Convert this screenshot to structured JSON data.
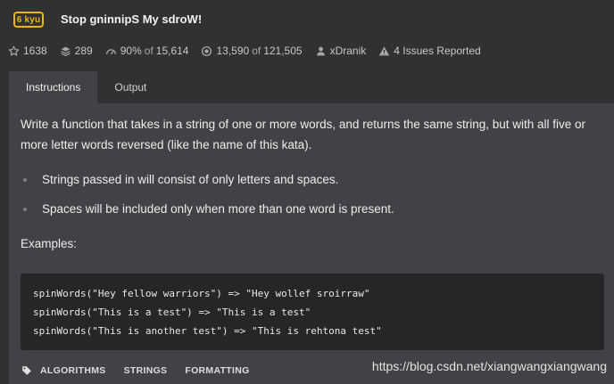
{
  "kata": {
    "rank": "6 kyu",
    "title": "Stop gninnipS My sdroW!"
  },
  "stats": {
    "stars": "1638",
    "collections": "289",
    "satisfaction": "90%",
    "satisfaction_of": "of",
    "satisfaction_total": "15,614",
    "completed": "13,590",
    "completed_of": "of",
    "completed_total": "121,505",
    "author": "xDranik",
    "issues": "4 Issues Reported"
  },
  "tabs": [
    {
      "label": "Instructions",
      "active": true
    },
    {
      "label": "Output",
      "active": false
    }
  ],
  "instructions": {
    "description": "Write a function that takes in a string of one or more words, and returns the same string, but with all five or more letter words reversed (like the name of this kata).",
    "bullets": [
      "Strings passed in will consist of only letters and spaces.",
      "Spaces will be included only when more than one word is present."
    ],
    "examples_heading": "Examples:",
    "code_lines": [
      "spinWords(\"Hey fellow warriors\") => \"Hey wollef sroirraw\"",
      "spinWords(\"This is a test\") => \"This is a test\"",
      "spinWords(\"This is another test\") => \"This is rehtona test\""
    ]
  },
  "tags": [
    "ALGORITHMS",
    "STRINGS",
    "FORMATTING"
  ],
  "watermark": "https://blog.csdn.net/xiangwangxiangwang",
  "colors": {
    "background": "#303133",
    "panel": "#404245",
    "code_bg": "#252628",
    "kyu_yellow": "#ecb613"
  }
}
